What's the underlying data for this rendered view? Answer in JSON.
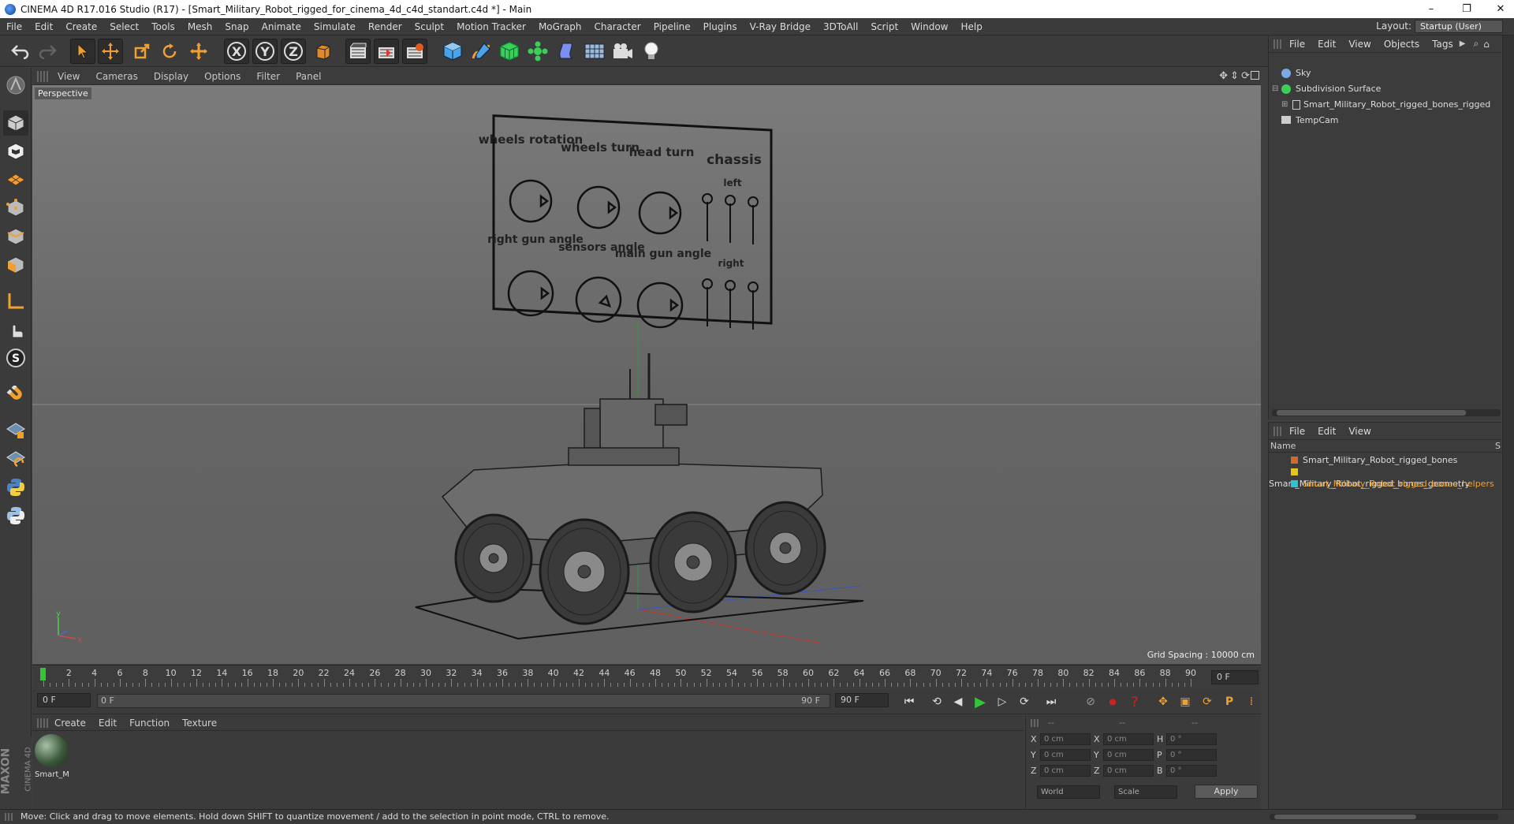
{
  "window": {
    "title": "CINEMA 4D R17.016 Studio (R17) - [Smart_Military_Robot_rigged_for_cinema_4d_c4d_standart.c4d *] - Main",
    "minimize": "–",
    "restore": "❐",
    "close": "✕"
  },
  "menubar": {
    "items": [
      "File",
      "Edit",
      "Create",
      "Select",
      "Tools",
      "Mesh",
      "Snap",
      "Animate",
      "Simulate",
      "Render",
      "Sculpt",
      "Motion Tracker",
      "MoGraph",
      "Character",
      "Pipeline",
      "Plugins",
      "V-Ray Bridge",
      "3DToAll",
      "Script",
      "Window",
      "Help"
    ],
    "layout_label": "Layout:",
    "layout_value": "Startup (User)"
  },
  "toolbar": {
    "axis_x": "X",
    "axis_y": "Y",
    "axis_z": "Z"
  },
  "viewport": {
    "menu": [
      "View",
      "Cameras",
      "Display",
      "Options",
      "Filter",
      "Panel"
    ],
    "label": "Perspective",
    "grid_spacing": "Grid Spacing : 10000 cm",
    "panel_text": {
      "wheels_rotation": "wheels rotation",
      "wheels_turn": "wheels turn",
      "head_turn": "head turn",
      "chassis": "chassis",
      "left": "left",
      "right_gun_angle": "right gun angle",
      "sensors_angle": "sensors angle",
      "main_gun_angle": "main gun angle",
      "right": "right"
    },
    "axis_x": "x",
    "axis_y": "y"
  },
  "timeline": {
    "ticks": [
      "0",
      "2",
      "4",
      "6",
      "8",
      "10",
      "12",
      "14",
      "16",
      "18",
      "20",
      "22",
      "24",
      "26",
      "28",
      "30",
      "32",
      "34",
      "36",
      "38",
      "40",
      "42",
      "44",
      "46",
      "48",
      "50",
      "52",
      "54",
      "56",
      "58",
      "60",
      "62",
      "64",
      "66",
      "68",
      "70",
      "72",
      "74",
      "76",
      "78",
      "80",
      "82",
      "84",
      "86",
      "88",
      "90"
    ],
    "current_frame": "0 F"
  },
  "transport": {
    "start_frame": "0 F",
    "range_start": "0 F",
    "range_end": "90 F",
    "end_frame": "90 F"
  },
  "material_manager": {
    "menu": [
      "Create",
      "Edit",
      "Function",
      "Texture"
    ],
    "material_name": "Smart_M"
  },
  "coordinates": {
    "headers": [
      "--",
      "--",
      "--"
    ],
    "rows": [
      {
        "l1": "X",
        "v1": "0 cm",
        "l2": "X",
        "v2": "0 cm",
        "l3": "H",
        "v3": "0 °"
      },
      {
        "l1": "Y",
        "v1": "0 cm",
        "l2": "Y",
        "v2": "0 cm",
        "l3": "P",
        "v3": "0 °"
      },
      {
        "l1": "Z",
        "v1": "0 cm",
        "l2": "Z",
        "v2": "0 cm",
        "l3": "B",
        "v3": "0 °"
      }
    ],
    "world": "World",
    "scale": "Scale",
    "apply": "Apply"
  },
  "object_manager": {
    "menu": [
      "File",
      "Edit",
      "View",
      "Objects",
      "Tags"
    ],
    "objects": [
      "Sky",
      "Subdivision Surface",
      "Smart_Military_Robot_rigged_bones_rigged",
      "TempCam"
    ]
  },
  "layer_manager": {
    "menu": [
      "File",
      "Edit",
      "View"
    ],
    "name_header": "Name",
    "s_header": "S",
    "layers": [
      {
        "name": "Smart_Military_Robot_rigged_bones",
        "color": "#d0692a",
        "highlight": false
      },
      {
        "name": "Smart_Military_Robot_rigged_bones_geometry",
        "color": "#e6c51a",
        "highlight": false
      },
      {
        "name": "Smart_Military_Robot_rigged_bones_helpers",
        "color": "#2ac6d6",
        "highlight": true
      }
    ]
  },
  "status": {
    "text": "Move: Click and drag to move elements. Hold down SHIFT to quantize movement / add to the selection in point mode, CTRL to remove."
  },
  "branding": {
    "maxon": "MAXON",
    "cinema": "CINEMA 4D"
  },
  "colors": {
    "accent_orange": "#f0a030",
    "highlight_layer": "#f0a030",
    "play_green": "#35c435",
    "record_red": "#d02020"
  }
}
